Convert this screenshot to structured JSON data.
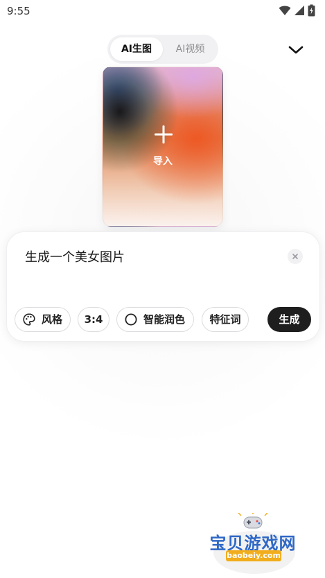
{
  "status_bar": {
    "time": "9:55"
  },
  "mode_tabs": [
    {
      "label": "AI生图",
      "active": true
    },
    {
      "label": "AI视频",
      "active": false
    }
  ],
  "import_card": {
    "label": "导入",
    "icon": "plus-icon"
  },
  "prompt": {
    "text": "生成一个美女图片"
  },
  "options": {
    "style_label": "风格",
    "ratio_label": "3:4",
    "polish_label": "智能润色",
    "keyword_label": "特征词"
  },
  "generate_label": "生成",
  "watermark": {
    "title": "宝贝游戏网",
    "url": "baobeiy.com"
  },
  "colors": {
    "generate_button": "#1e1e1e",
    "watermark_title": "#2f68c6",
    "watermark_badge": "#f1ad1c"
  }
}
